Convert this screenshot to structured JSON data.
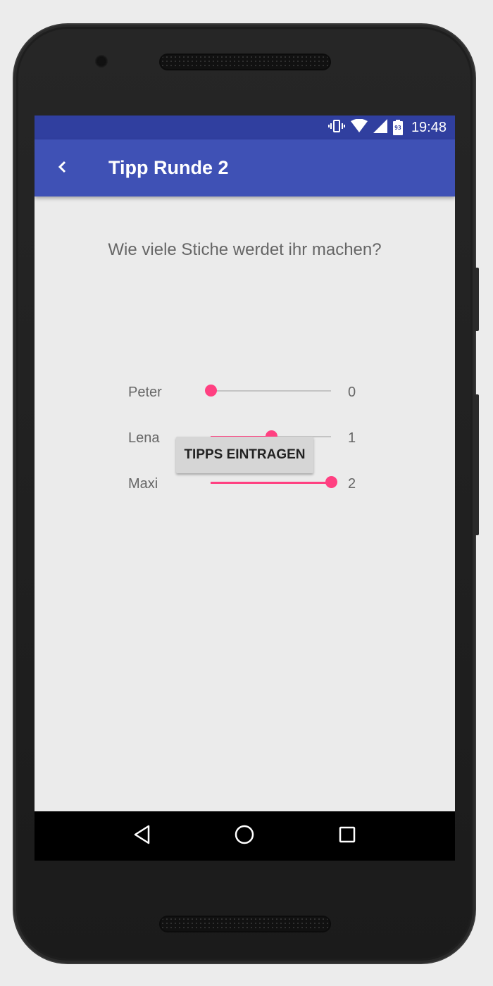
{
  "status_bar": {
    "time": "19:48",
    "battery_level": "93",
    "icons": [
      "vibrate-icon",
      "wifi-icon",
      "signal-icon",
      "battery-icon"
    ]
  },
  "app_bar": {
    "title": "Tipp Runde 2",
    "back_icon": "chevron-left-icon",
    "color": "#3f51b5",
    "status_color": "#303f9f"
  },
  "main": {
    "question": "Wie viele Stiche werdet ihr machen?",
    "slider_max": 2,
    "accent_color": "#ff4081",
    "players": [
      {
        "name": "Peter",
        "value": "0",
        "fraction": 0.0
      },
      {
        "name": "Lena",
        "value": "1",
        "fraction": 0.5
      },
      {
        "name": "Maxi",
        "value": "2",
        "fraction": 1.0
      }
    ],
    "submit_label": "TIPPS EINTRAGEN"
  },
  "nav_bar": {
    "icons": [
      "back-triangle-icon",
      "home-circle-icon",
      "recents-square-icon"
    ]
  }
}
